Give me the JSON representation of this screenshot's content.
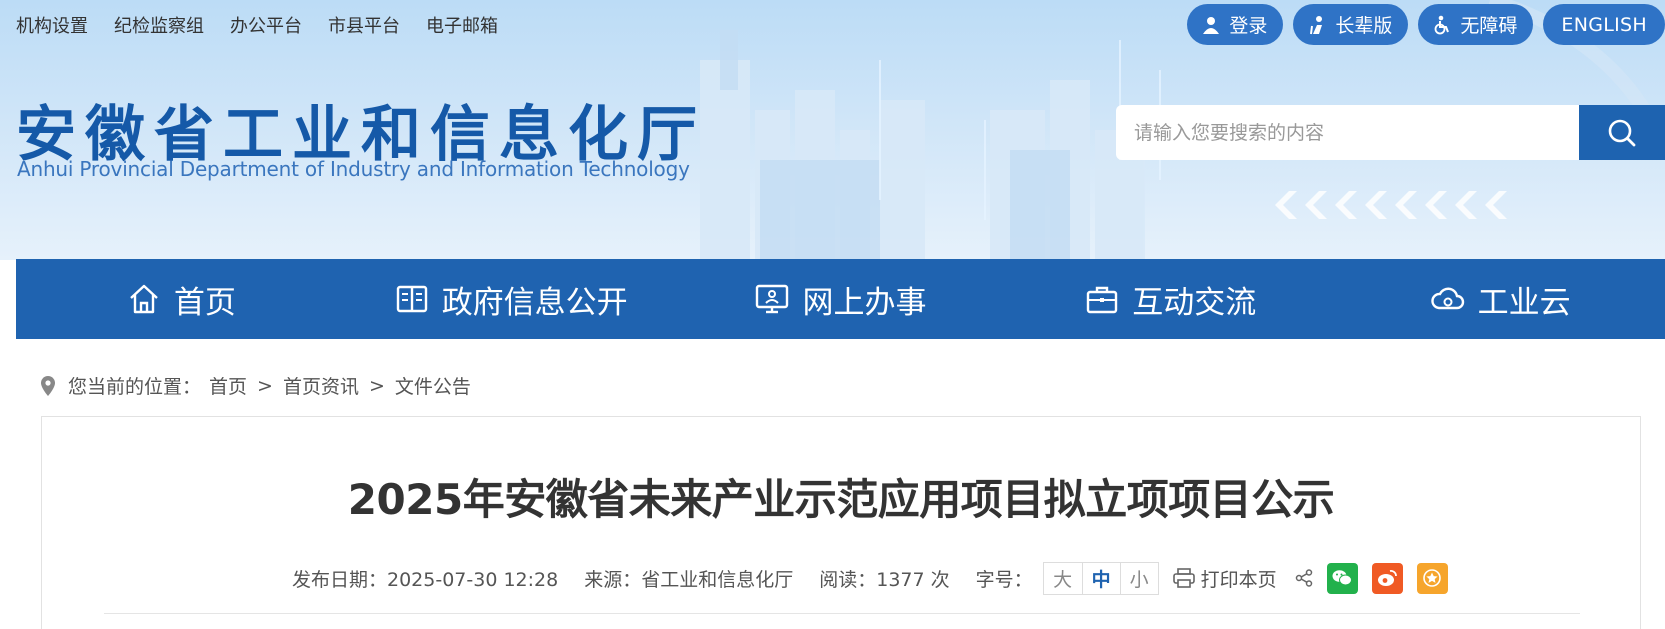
{
  "top_links": [
    "机构设置",
    "纪检监察组",
    "办公平台",
    "市县平台",
    "电子邮箱"
  ],
  "top_buttons": {
    "login": "登录",
    "elder": "长辈版",
    "accessible": "无障碍",
    "english": "ENGLISH"
  },
  "logo": {
    "cn": "安徽省工业和信息化厅",
    "en": "Anhui Provincial Department of Industry and Information Technology"
  },
  "search": {
    "placeholder": "请输入您要搜索的内容"
  },
  "nav": [
    {
      "label": "首页",
      "icon": "home-icon"
    },
    {
      "label": "政府信息公开",
      "icon": "book-icon"
    },
    {
      "label": "网上办事",
      "icon": "monitor-icon"
    },
    {
      "label": "互动交流",
      "icon": "briefcase-icon"
    },
    {
      "label": "工业云",
      "icon": "cloud-gear-icon"
    }
  ],
  "breadcrumb": {
    "prefix": "您当前的位置：",
    "items": [
      "首页",
      "首页资讯",
      "文件公告"
    ],
    "sep": ">"
  },
  "article": {
    "title": "2025年安徽省未来产业示范应用项目拟立项项目公示",
    "date_label": "发布日期：2025-07-30 12:28",
    "source_label": "来源：省工业和信息化厅",
    "reads_label": "阅读：1377 次",
    "font_size_label": "字号：",
    "font_sizes": [
      "大",
      "中",
      "小"
    ],
    "print_label": "打印本页"
  },
  "colors": {
    "brand_blue": "#1f63b0",
    "pill_blue": "#2f73c6",
    "wechat": "#22b14c",
    "weibo": "#f05a24",
    "favorite": "#f6a52c"
  }
}
